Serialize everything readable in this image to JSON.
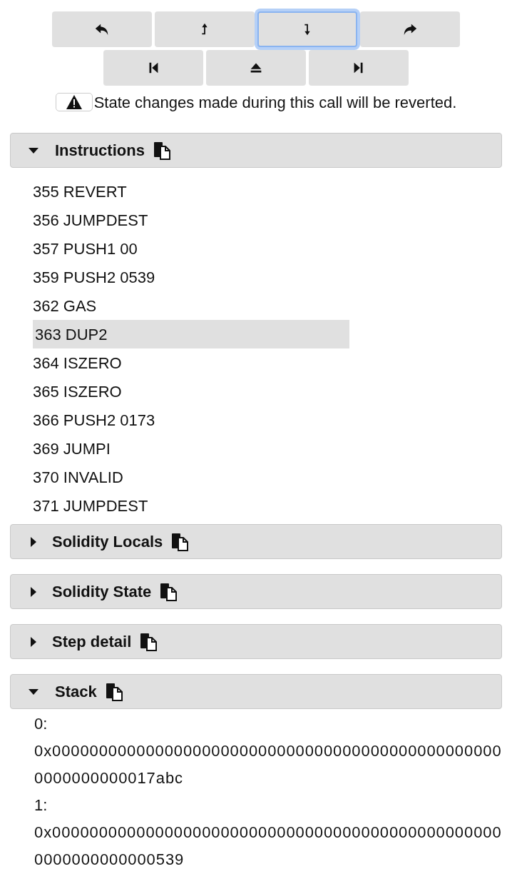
{
  "control_rows": [
    [
      {
        "kind": "step-back",
        "focused": false
      },
      {
        "kind": "step-over-back",
        "focused": false
      },
      {
        "kind": "step-into",
        "focused": true
      },
      {
        "kind": "step-over-forward",
        "focused": false
      }
    ],
    [
      {
        "kind": "jump-start",
        "focused": false
      },
      {
        "kind": "jump-out",
        "focused": false
      },
      {
        "kind": "jump-end",
        "focused": false
      }
    ]
  ],
  "warning": {
    "text": "State changes made during this call will be reverted."
  },
  "panels": [
    {
      "kind": "instructions",
      "title": "Instructions",
      "expanded": true,
      "items": [
        {
          "text": "355 REVERT",
          "selected": false
        },
        {
          "text": "356 JUMPDEST",
          "selected": false
        },
        {
          "text": "357 PUSH1 00",
          "selected": false
        },
        {
          "text": "359 PUSH2 0539",
          "selected": false
        },
        {
          "text": "362 GAS",
          "selected": false
        },
        {
          "text": "363 DUP2",
          "selected": true
        },
        {
          "text": "364 ISZERO",
          "selected": false
        },
        {
          "text": "365 ISZERO",
          "selected": false
        },
        {
          "text": "366 PUSH2 0173",
          "selected": false
        },
        {
          "text": "369 JUMPI",
          "selected": false
        },
        {
          "text": "370 INVALID",
          "selected": false
        },
        {
          "text": "371 JUMPDEST",
          "selected": false
        }
      ]
    },
    {
      "title": "Solidity Locals",
      "expanded": false
    },
    {
      "title": "Solidity State",
      "expanded": false
    },
    {
      "title": "Step detail",
      "expanded": false
    },
    {
      "kind": "stack",
      "title": "Stack",
      "expanded": true,
      "entries": [
        {
          "index": "0:",
          "value": "0x0000000000000000000000000000000000000000000000000000000000017abc"
        },
        {
          "index": "1:",
          "value": "0x0000000000000000000000000000000000000000000000000000000000000539"
        }
      ]
    }
  ]
}
